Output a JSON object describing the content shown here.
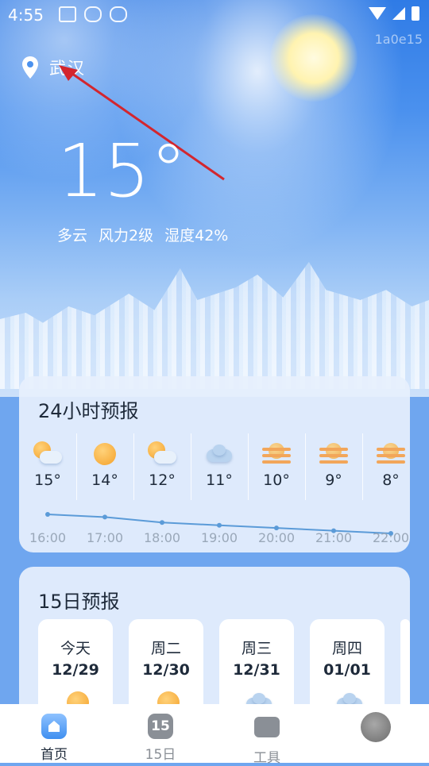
{
  "status_bar": {
    "time": "4:55",
    "watermark": "1a0e15"
  },
  "location": {
    "city": "武汉"
  },
  "current": {
    "temperature": "15°",
    "condition": "多云",
    "wind": "风力2级",
    "humidity": "湿度42%"
  },
  "hourly_card": {
    "title": "24小时预报",
    "hours": [
      {
        "time": "16:00",
        "temp": "15°",
        "icon": "partly-cloudy-icon",
        "value": 15
      },
      {
        "time": "17:00",
        "temp": "14°",
        "icon": "sunny-icon",
        "value": 14
      },
      {
        "time": "18:00",
        "temp": "12°",
        "icon": "partly-cloudy-icon",
        "value": 12
      },
      {
        "time": "19:00",
        "temp": "11°",
        "icon": "cloudy-icon",
        "value": 11
      },
      {
        "time": "20:00",
        "temp": "10°",
        "icon": "haze-icon",
        "value": 10
      },
      {
        "time": "21:00",
        "temp": "9°",
        "icon": "haze-icon",
        "value": 9
      },
      {
        "time": "22:00",
        "temp": "8°",
        "icon": "haze-icon",
        "value": 8
      }
    ]
  },
  "daily_card": {
    "title": "15日预报",
    "days": [
      {
        "name": "今天",
        "date": "12/29",
        "icon": "sunny-icon"
      },
      {
        "name": "周二",
        "date": "12/30",
        "icon": "sunny-icon"
      },
      {
        "name": "周三",
        "date": "12/31",
        "icon": "cloudy-icon"
      },
      {
        "name": "周四",
        "date": "01/01",
        "icon": "cloudy-icon"
      }
    ]
  },
  "tabs": [
    {
      "label": "首页",
      "icon": "home-icon"
    },
    {
      "label": "15日",
      "icon": "calendar-15-icon",
      "badge": "15"
    },
    {
      "label": "工具",
      "icon": "toolbox-icon"
    }
  ],
  "colors": {
    "accent": "#3f8ff0",
    "line": "#5b9bd8",
    "text": "#1e2a3a",
    "muted": "#9aa8b9"
  }
}
